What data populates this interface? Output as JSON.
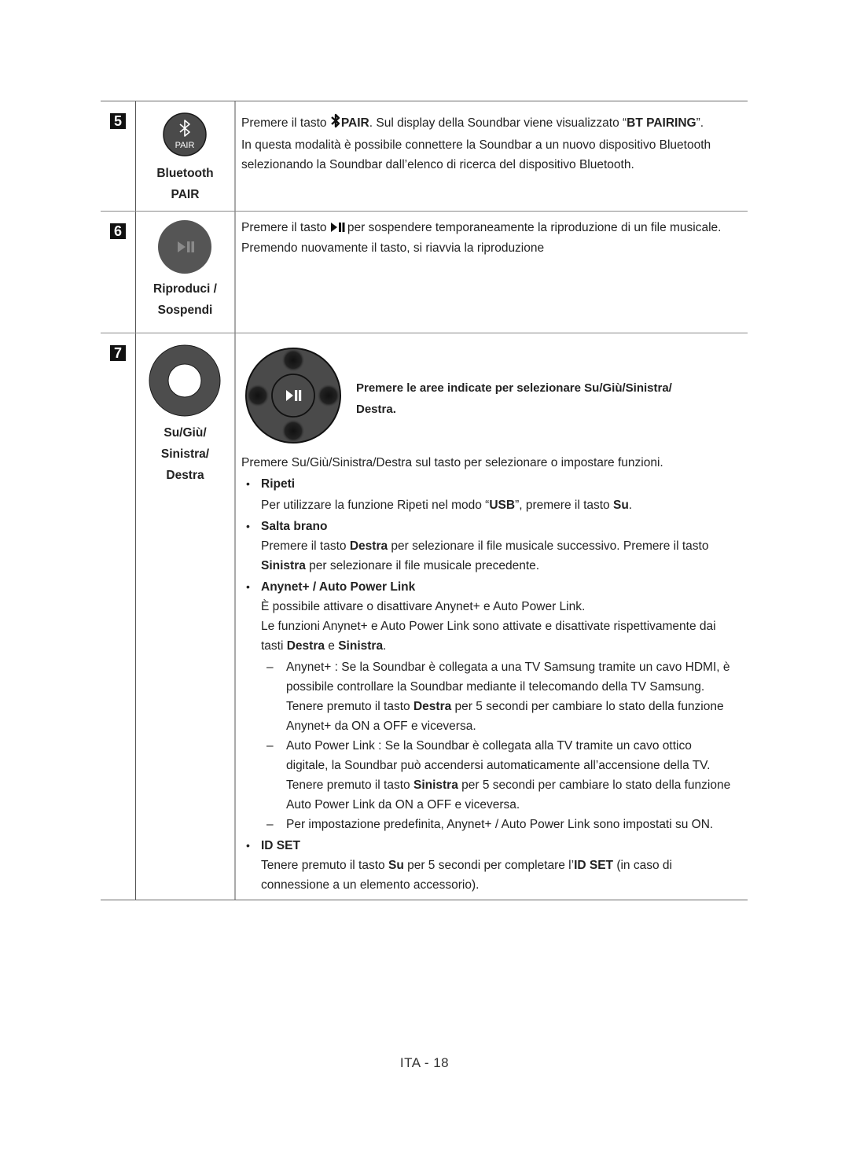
{
  "rows": [
    {
      "number": "5",
      "icon": "bluetooth-pair-icon",
      "icon_text": "PAIR",
      "label_line1": "Bluetooth",
      "label_line2": "PAIR",
      "desc": {
        "l1_a": "Premere il tasto ",
        "l1_b": "PAIR",
        "l1_c": ". Sul display della Soundbar viene visualizzato “",
        "l1_d": "BT PAIRING",
        "l1_e": "”.",
        "l2": "In questa modalità è possibile connettere la Soundbar a un nuovo dispositivo Bluetooth",
        "l3": "selezionando la Soundbar dall’elenco di ricerca del dispositivo Bluetooth."
      }
    },
    {
      "number": "6",
      "icon": "play-pause-icon",
      "label_line1": "Riproduci /",
      "label_line2": "Sospendi",
      "desc": {
        "l1_a": "Premere il tasto ",
        "l1_b": "per sospendere temporaneamente la riproduzione di un file musicale.",
        "l2": "Premendo nuovamente il tasto, si riavvia la riproduzione"
      }
    },
    {
      "number": "7",
      "icon": "direction-ring-icon",
      "label_line1": "Su/Giù/",
      "label_line2": "Sinistra/",
      "label_line3": "Destra",
      "pad_caption_l1": "Premere le aree indicate per selezionare Su/Giù/Sinistra/",
      "pad_caption_l2": "Destra.",
      "intro": "Premere Su/Giù/Sinistra/Destra sul tasto per selezionare o impostare funzioni.",
      "bullets": {
        "ripeti_title": "Ripeti",
        "ripeti_a": "Per utilizzare la funzione Ripeti nel modo “",
        "ripeti_b": "USB",
        "ripeti_c": "”, premere il tasto ",
        "ripeti_d": "Su",
        "ripeti_e": ".",
        "salta_title": "Salta brano",
        "salta_a": "Premere il tasto ",
        "salta_b": "Destra",
        "salta_c": " per selezionare il file musicale successivo. Premere il tasto",
        "salta_d": "Sinistra",
        "salta_e": " per selezionare il file musicale precedente.",
        "anynet_title": "Anynet+ / Auto Power Link",
        "anynet_l1": "È possibile attivare o disattivare Anynet+ e Auto Power Link.",
        "anynet_l2": "Le funzioni Anynet+ e Auto Power Link sono attivate e disattivate rispettivamente dai",
        "anynet_l3_a": "tasti ",
        "anynet_l3_b": "Destra",
        "anynet_l3_c": " e ",
        "anynet_l3_d": "Sinistra",
        "anynet_l3_e": ".",
        "dash_mark": "–",
        "d1_l1": "Anynet+ : Se la Soundbar è collegata a una TV Samsung tramite un cavo HDMI, è",
        "d1_l2": "possibile controllare la Soundbar mediante il telecomando della TV Samsung.",
        "d1_l3_a": "Tenere premuto il tasto ",
        "d1_l3_b": "Destra",
        "d1_l3_c": " per 5 secondi per cambiare lo stato della funzione",
        "d1_l4": "Anynet+ da ON a OFF e viceversa.",
        "d2_l1": "Auto Power Link : Se la Soundbar è collegata alla TV tramite un cavo ottico",
        "d2_l2": "digitale, la Soundbar può accendersi automaticamente all’accensione della TV.",
        "d2_l3_a": "Tenere premuto il tasto ",
        "d2_l3_b": "Sinistra",
        "d2_l3_c": " per 5 secondi per cambiare lo stato della funzione",
        "d2_l4": "Auto Power Link da ON a OFF e viceversa.",
        "d3_l1": "Per impostazione predefinita, Anynet+ / Auto Power Link sono impostati su ON.",
        "idset_title": "ID SET",
        "idset_a": "Tenere premuto il tasto ",
        "idset_b": "Su",
        "idset_c": " per 5 secondi per completare l’",
        "idset_d": "ID SET",
        "idset_e": " (in caso di",
        "idset_l2": "connessione a un elemento accessorio)."
      }
    }
  ],
  "bullet_glyph": "•",
  "footer": "ITA - 18"
}
